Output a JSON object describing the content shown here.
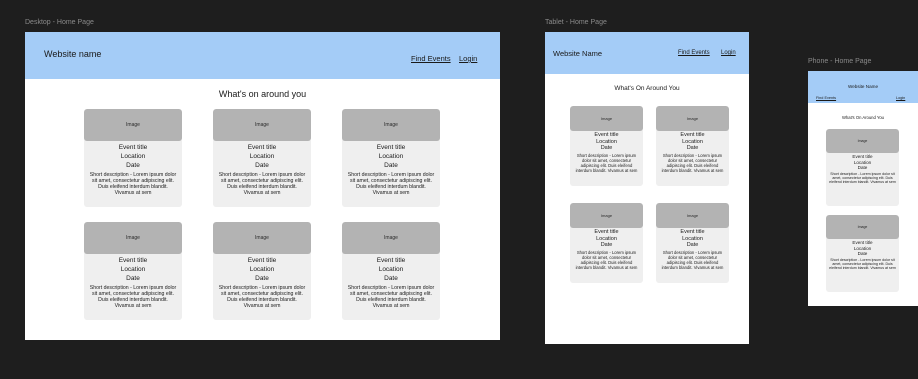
{
  "desktop": {
    "label": "Desktop - Home Page",
    "site_name": "Website name",
    "nav": {
      "find_events": "Find Events",
      "login": "Login"
    },
    "heading": "What's on around you"
  },
  "tablet": {
    "label": "Tablet - Home Page",
    "site_name": "Website Name",
    "nav": {
      "find_events": "Find Events",
      "login": "Login"
    },
    "heading": "What's On Around You"
  },
  "phone": {
    "label": "Phone - Home Page",
    "site_name": "Website Name",
    "nav": {
      "find_events": "Find Events",
      "login": "Login"
    },
    "heading": "What's On Around You"
  },
  "card": {
    "image": "Image",
    "title": "Event title",
    "location": "Location",
    "date": "Date",
    "description": "Short description - Lorem ipsum dolor sit amet, consectetur adipiscing elit. Duis eleifend interdum blandit. Vivamus at sem"
  },
  "colors": {
    "canvas": "#1e1e1e",
    "nav": "#a4ccf7",
    "card": "#efefef",
    "image": "#b3b3b3"
  }
}
